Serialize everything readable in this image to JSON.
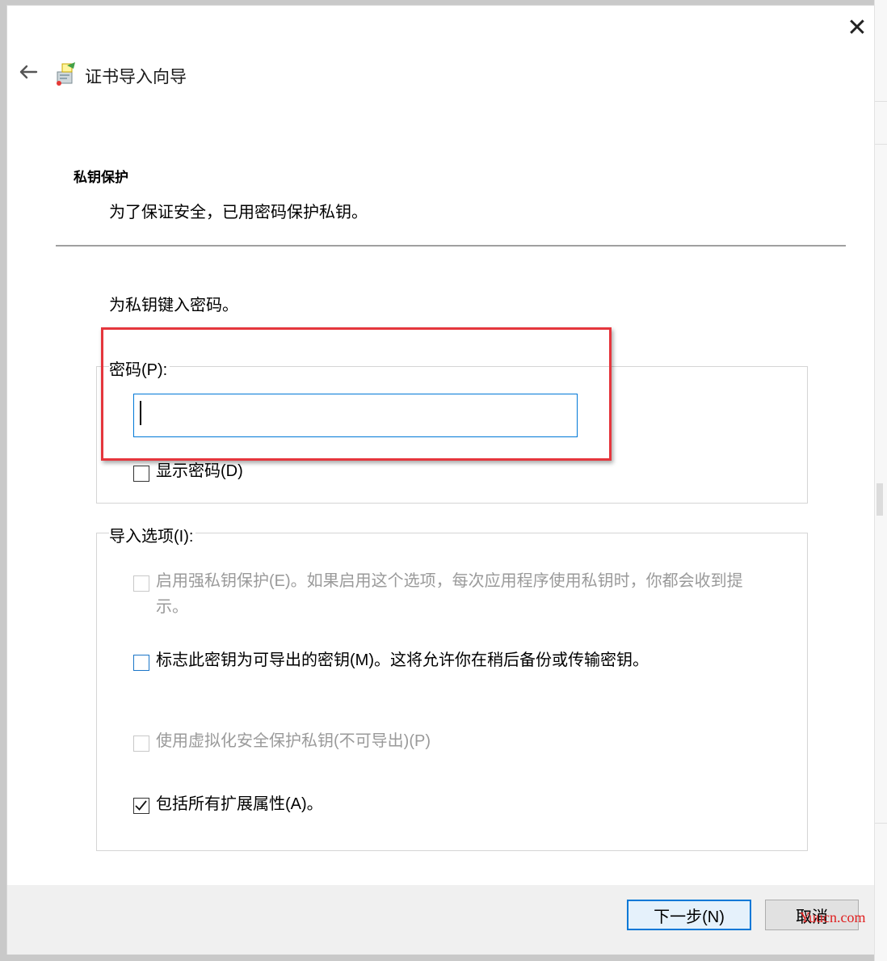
{
  "window": {
    "close_glyph": "✕",
    "back_glyph": "🡐",
    "title": "证书导入向导",
    "icon": "certificate-wizard-icon"
  },
  "header": {
    "section_title": "私钥保护",
    "section_desc": "为了保证安全，已用密码保护私钥。"
  },
  "body": {
    "prompt": "为私钥键入密码。",
    "password_group_label": "密码(P):",
    "password_value": "",
    "show_password": {
      "label": "显示密码(D)",
      "checked": false
    },
    "import_options_label": "导入选项(I):",
    "options": [
      {
        "label": "启用强私钥保护(E)。如果启用这个选项，每次应用程序使用私钥时，你都会收到提",
        "label_cont": "示。",
        "checked": false,
        "disabled": true
      },
      {
        "label": "标志此密钥为可导出的密钥(M)。这将允许你在稍后备份或传输密钥。",
        "checked": false,
        "disabled": false
      },
      {
        "label": "使用虚拟化安全保护私钥(不可导出)(P)",
        "checked": false,
        "disabled": true
      },
      {
        "label": "包括所有扩展属性(A)。",
        "checked": true,
        "disabled": false
      }
    ]
  },
  "footer": {
    "next_label": "下一步(N)",
    "cancel_label": "取消"
  },
  "watermark": "Yuucn.com",
  "colors": {
    "accent": "#0078d7",
    "highlight": "#e5363d"
  }
}
